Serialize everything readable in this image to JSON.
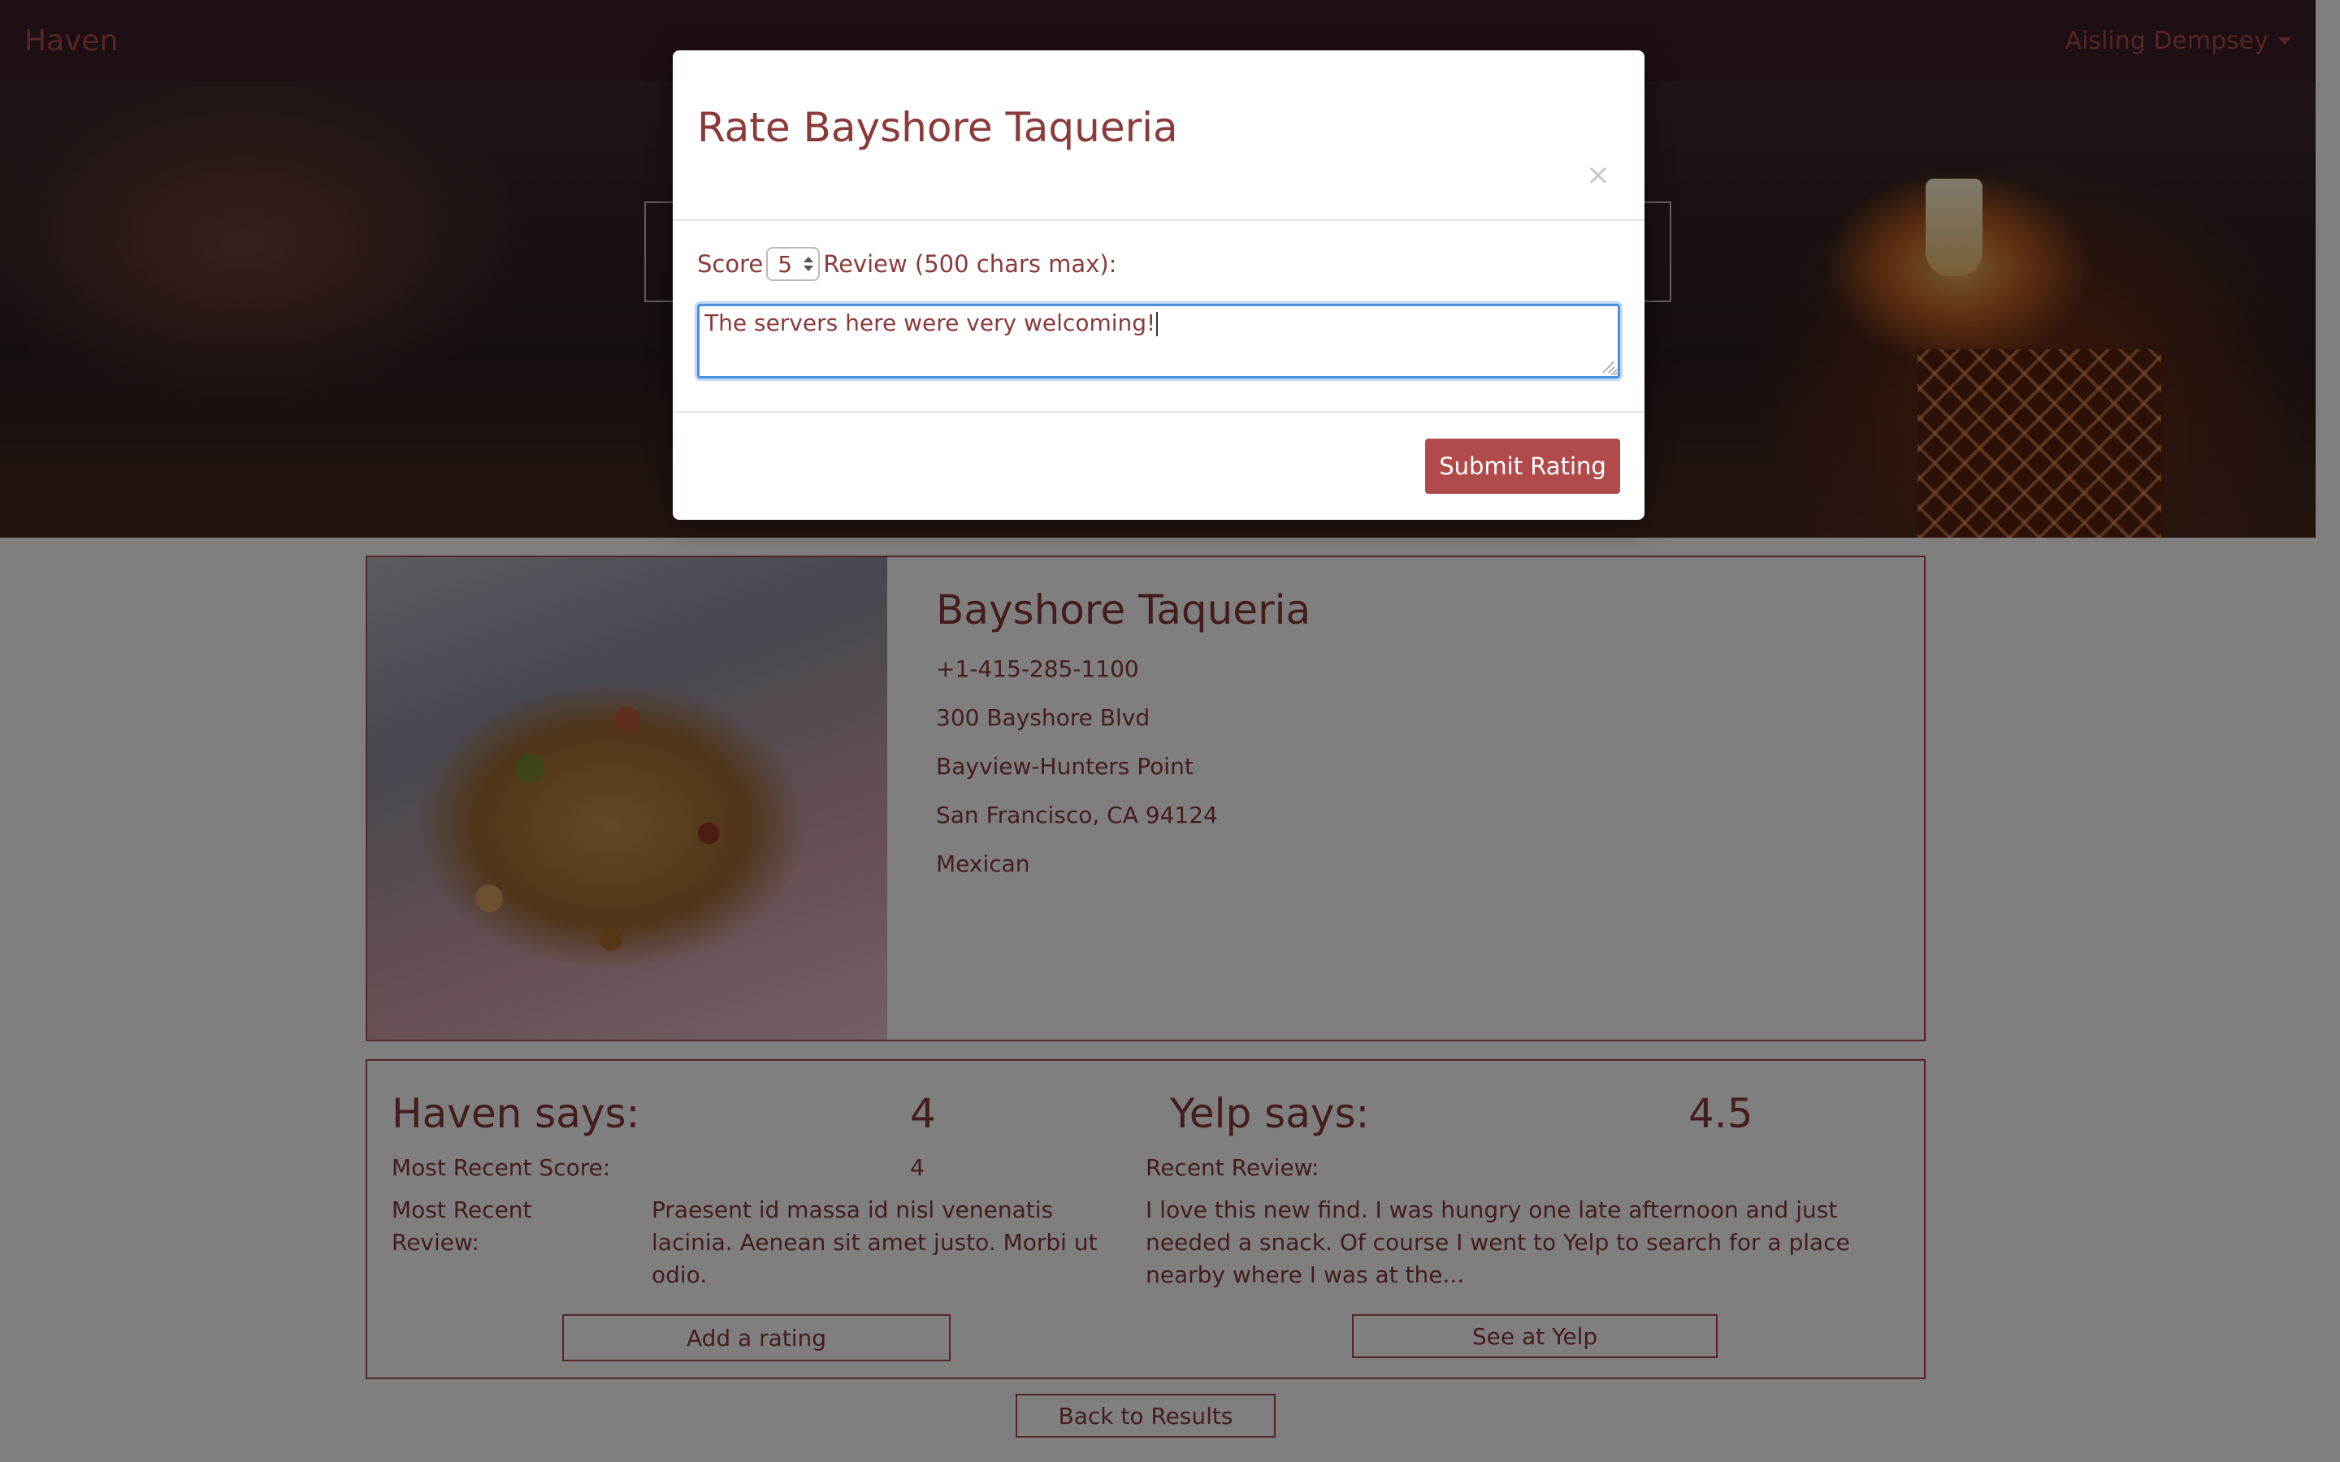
{
  "navbar": {
    "brand": "Haven",
    "user_name": "Aisling Dempsey"
  },
  "restaurant": {
    "name": "Bayshore Taqueria",
    "phone": "+1-415-285-1100",
    "address": "300 Bayshore Blvd",
    "neighborhood": "Bayview-Hunters Point",
    "city_state_zip": "San Francisco, CA 94124",
    "category": "Mexican"
  },
  "haven": {
    "label": "Haven says:",
    "score": "4",
    "recent_score_label": "Most Recent Score:",
    "recent_score": "4",
    "recent_review_label": "Most Recent Review:",
    "recent_review": "Praesent id massa id nisl venenatis lacinia. Aenean sit amet justo. Morbi ut odio.",
    "add_rating_button": "Add a rating"
  },
  "yelp": {
    "label": "Yelp says:",
    "score": "4.5",
    "recent_review_label": "Recent Review:",
    "recent_review": "I love this new find. I was hungry one late afternoon and just needed a snack. Of course I went to Yelp to search for a place nearby where I was at the...",
    "see_button": "See at Yelp"
  },
  "back_button": "Back to Results",
  "modal": {
    "title": "Rate Bayshore Taqueria",
    "close_symbol": "×",
    "score_label": "Score",
    "score_value": "5",
    "review_label": "Review (500 chars max):",
    "review_text": "The servers here were very welcoming!",
    "submit_label": "Submit Rating"
  },
  "colors": {
    "accent": "#b14b4b",
    "text": "#8b3a3a",
    "navbar_bg": "#3d1f28",
    "focus_ring": "#4a8fe0"
  }
}
